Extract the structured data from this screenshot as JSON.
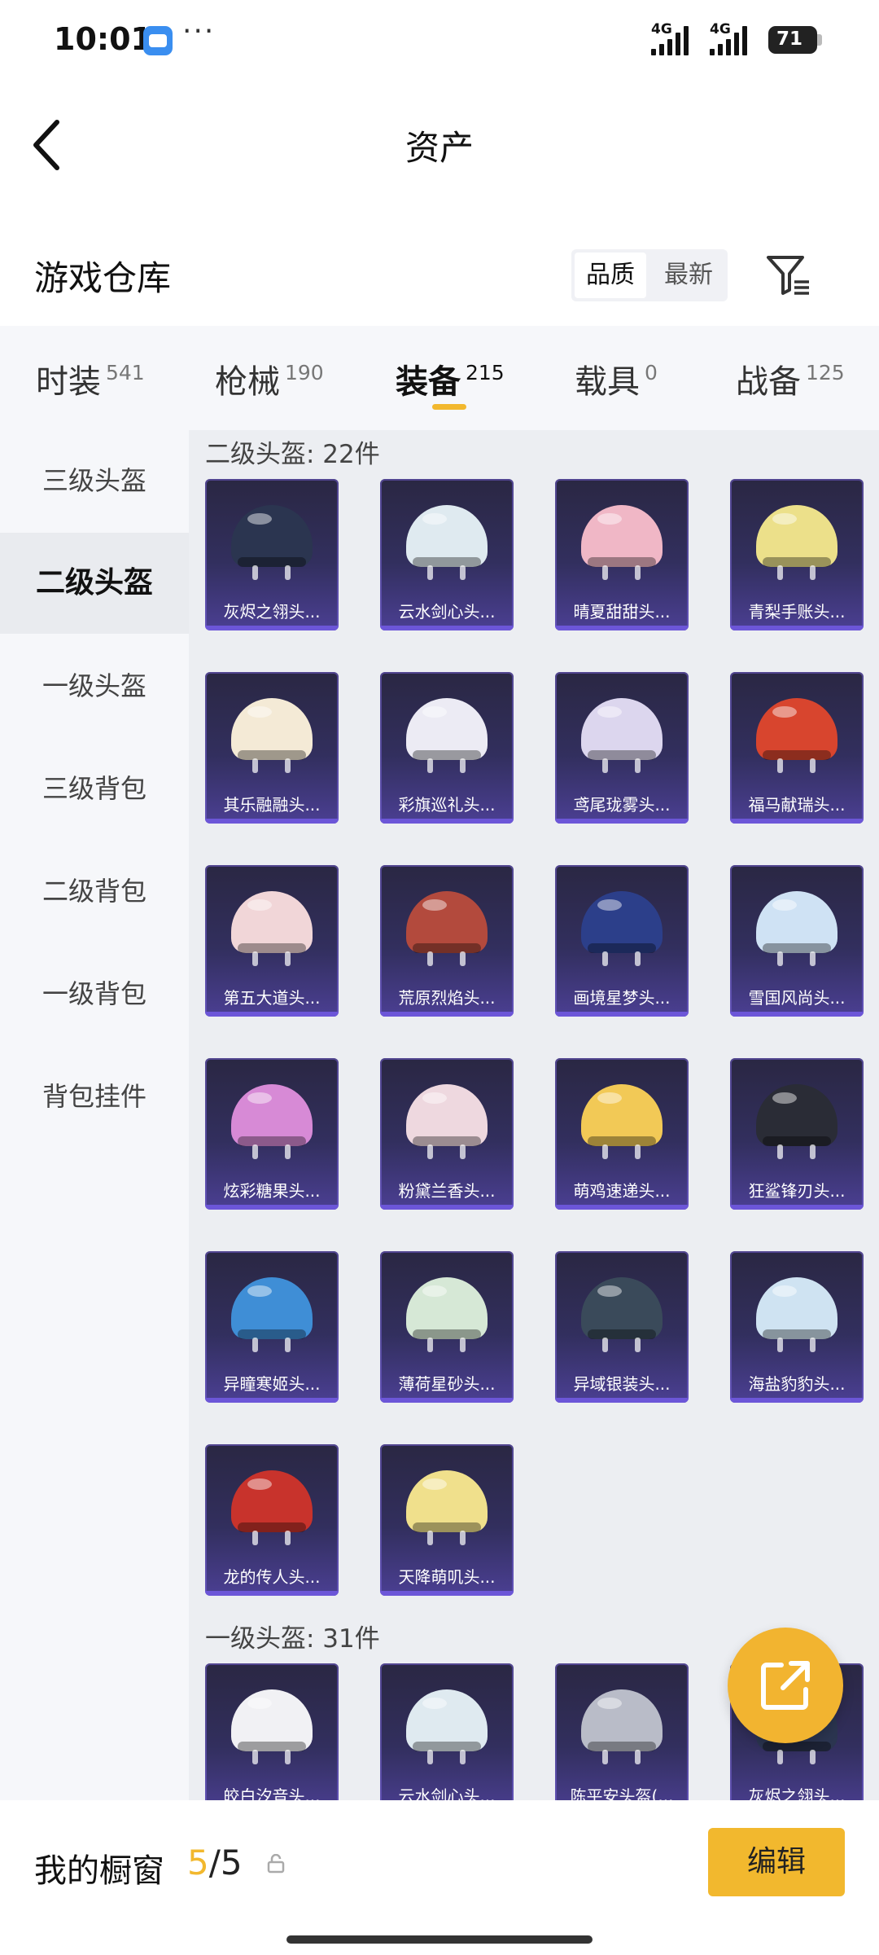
{
  "status_bar": {
    "time": "10:01",
    "dots": "···",
    "network_1": "4G",
    "network_2": "4G",
    "battery": "71"
  },
  "header": {
    "title": "资产",
    "back_icon": "chevron-left-icon"
  },
  "warehouse": {
    "title": "游戏仓库",
    "sort_options": [
      "品质",
      "最新"
    ],
    "sort_selected": "品质",
    "filter_icon": "filter-icon"
  },
  "tabs": [
    {
      "label": "时装",
      "count": "541"
    },
    {
      "label": "枪械",
      "count": "190"
    },
    {
      "label": "装备",
      "count": "215",
      "active": true
    },
    {
      "label": "载具",
      "count": "0"
    },
    {
      "label": "战备",
      "count": "125"
    }
  ],
  "sidebar": {
    "items": [
      "三级头盔",
      "二级头盔",
      "一级头盔",
      "三级背包",
      "二级背包",
      "一级背包",
      "背包挂件"
    ],
    "selected": "二级头盔"
  },
  "sections": [
    {
      "title": "二级头盔: 22件",
      "items": [
        {
          "name": "灰烬之翎头...",
          "color": "#2b3550"
        },
        {
          "name": "云水剑心头...",
          "color": "#dfeaf0"
        },
        {
          "name": "晴夏甜甜头...",
          "color": "#f0b7c6"
        },
        {
          "name": "青梨手账头...",
          "color": "#ece08a"
        },
        {
          "name": "其乐融融头...",
          "color": "#f4ead6"
        },
        {
          "name": "彩旗巡礼头...",
          "color": "#ecebf4"
        },
        {
          "name": "鸢尾珑雾头...",
          "color": "#dcd6ee"
        },
        {
          "name": "福马献瑞头...",
          "color": "#d8452e"
        },
        {
          "name": "第五大道头...",
          "color": "#f1d6d8"
        },
        {
          "name": "荒原烈焰头...",
          "color": "#b34a3d"
        },
        {
          "name": "画境星梦头...",
          "color": "#2c3f8a"
        },
        {
          "name": "雪国风尚头...",
          "color": "#cfe2f4"
        },
        {
          "name": "炫彩糖果头...",
          "color": "#d78ad6"
        },
        {
          "name": "粉黛兰香头...",
          "color": "#eed8df"
        },
        {
          "name": "萌鸡速递头...",
          "color": "#f2c956"
        },
        {
          "name": "狂鲨锋刃头...",
          "color": "#2a2c36"
        },
        {
          "name": "异瞳寒姬头...",
          "color": "#3f8ed6"
        },
        {
          "name": "薄荷星砂头...",
          "color": "#d6e8d6"
        },
        {
          "name": "异域银装头...",
          "color": "#3a4a5a"
        },
        {
          "name": "海盐豹豹头...",
          "color": "#cfe3f2"
        },
        {
          "name": "龙的传人头...",
          "color": "#c8332c"
        },
        {
          "name": "天降萌叽头...",
          "color": "#f0e08c"
        }
      ]
    },
    {
      "title": "一级头盔: 31件",
      "items": [
        {
          "name": "皎白汐音头...",
          "color": "#f1f1f4"
        },
        {
          "name": "云水剑心头...",
          "color": "#dfeaf0"
        },
        {
          "name": "陈平安头盔(...",
          "color": "#b9bcc8"
        },
        {
          "name": "灰烬之翎头...",
          "color": "#2b3550"
        }
      ]
    }
  ],
  "share_button_icon": "share-external-icon",
  "bottom_bar": {
    "label": "我的橱窗",
    "current": "5",
    "separator": "/",
    "total": "5",
    "lock_icon": "lock-icon",
    "edit_label": "编辑"
  },
  "colors": {
    "accent": "#f2b82e",
    "card_bg": "#322f5e",
    "sidebar_bg": "#f6f7fa",
    "content_bg": "#eceef2"
  }
}
